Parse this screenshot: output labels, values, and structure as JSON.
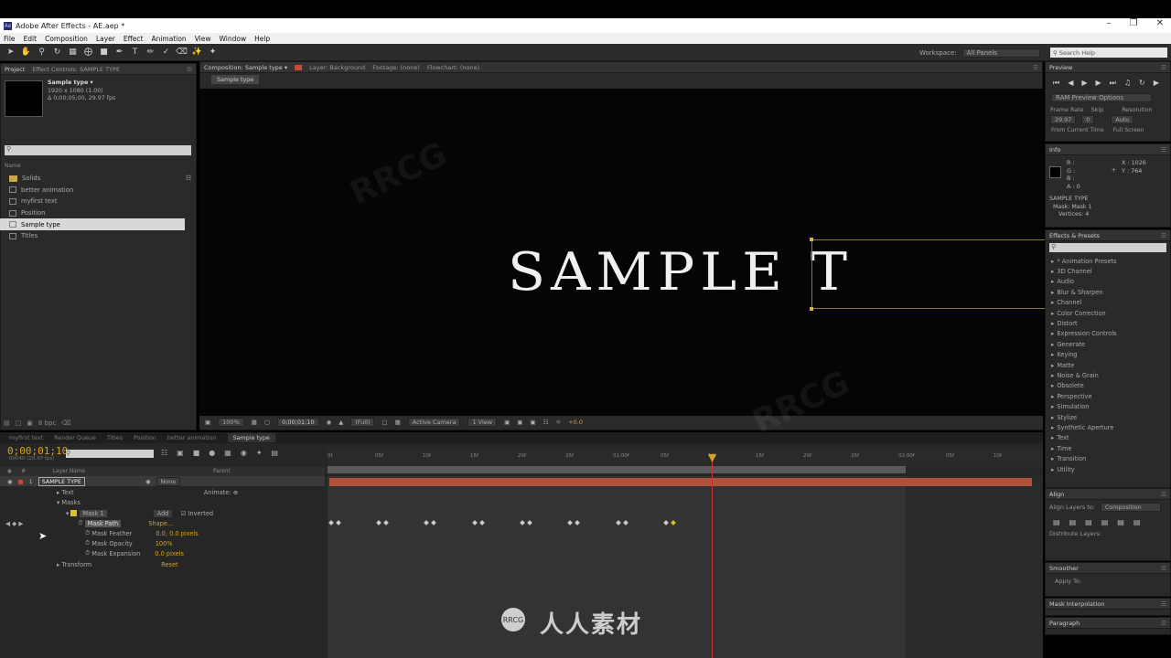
{
  "window": {
    "title": "Adobe After Effects - AE.aep *",
    "icon": "Ae"
  },
  "menu": [
    "File",
    "Edit",
    "Composition",
    "Layer",
    "Effect",
    "Animation",
    "View",
    "Window",
    "Help"
  ],
  "workspace": {
    "label": "Workspace:",
    "value": "All Panels"
  },
  "search_help": {
    "placeholder": "Search Help"
  },
  "project": {
    "tab": "Project",
    "tab2": "Effect Controls: SAMPLE TYPE",
    "selected_name": "Sample type ▾",
    "selected_dims": "1920 x 1080 (1.00)",
    "selected_dur": "Δ 0;00;05;00, 29.97 fps",
    "name_col": "Name",
    "items": [
      {
        "name": "Solids",
        "type": "folder"
      },
      {
        "name": "better animation",
        "type": "comp"
      },
      {
        "name": "myfirst text",
        "type": "comp"
      },
      {
        "name": "Position",
        "type": "comp"
      },
      {
        "name": "Sample type",
        "type": "comp",
        "selected": true
      },
      {
        "name": "Titles",
        "type": "comp"
      }
    ],
    "bpc": "8 bpc"
  },
  "composition": {
    "tab": "Composition: Sample type ▾",
    "layer_tab": "Layer: Background",
    "footage_tab": "Footage: (none)",
    "flowchart_tab": "Flowchart: (none)",
    "comp_name": "Sample type",
    "canvas_text": "SAMPLE T",
    "zoom": "100%",
    "time": "0;00;01;10",
    "resolution": "(Full)",
    "camera": "Active Camera",
    "views": "1 View",
    "exposure": "+0.0"
  },
  "preview": {
    "title": "Preview",
    "ram": "RAM Preview Options",
    "frame_rate_label": "Frame Rate",
    "skip_label": "Skip",
    "res_label": "Resolution",
    "frame_rate": "29.97",
    "skip": "0",
    "resolution": "Auto",
    "from_current": "From Current Time",
    "full_screen": "Full Screen"
  },
  "info": {
    "title": "Info",
    "r": "R :",
    "g": "G :",
    "b": "B :",
    "a": "A : 0",
    "x": "X : 1026",
    "y": "Y : 764",
    "layer": "SAMPLE TYPE",
    "mask": "Mask: Mask 1",
    "vertices": "Vertices: 4"
  },
  "effects": {
    "title": "Effects & Presets",
    "items": [
      "* Animation Presets",
      "3D Channel",
      "Audio",
      "Blur & Sharpen",
      "Channel",
      "Color Correction",
      "Distort",
      "Expression Controls",
      "Generate",
      "Keying",
      "Matte",
      "Noise & Grain",
      "Obsolete",
      "Perspective",
      "Simulation",
      "Stylize",
      "Synthetic Aperture",
      "Text",
      "Time",
      "Transition",
      "Utility"
    ]
  },
  "align": {
    "title": "Align",
    "layers_to_label": "Align Layers to:",
    "layers_to": "Composition",
    "distribute": "Distribute Layers:"
  },
  "smoother": {
    "title": "Smoother",
    "apply_to": "Apply To:"
  },
  "mask_interpolation": {
    "title": "Mask Interpolation"
  },
  "paragraph": {
    "title": "Paragraph"
  },
  "timeline": {
    "tabs": [
      "myfirst text",
      "Render Queue",
      "Titles",
      "Position",
      "better animation",
      "Sample type"
    ],
    "timecode": "0;00;01;10",
    "subtime": "00040 (29.97 fps)",
    "cols": {
      "num": "#",
      "layer_name": "Layer Name",
      "parent": "Parent"
    },
    "layer": {
      "num": "1",
      "name": "SAMPLE TYPE",
      "parent": "None"
    },
    "props": [
      {
        "label": "Text",
        "indent": 1,
        "value": "",
        "extra": "Animate:"
      },
      {
        "label": "Masks",
        "indent": 1
      },
      {
        "label": "Mask 1",
        "indent": 2,
        "value": "Add",
        "extra": "Inverted"
      },
      {
        "label": "Mask Path",
        "indent": 3,
        "value": "Shape..."
      },
      {
        "label": "Mask Feather",
        "indent": 3,
        "value": "0.0, 0.0 pixels"
      },
      {
        "label": "Mask Opacity",
        "indent": 3,
        "value": "100%"
      },
      {
        "label": "Mask Expansion",
        "indent": 3,
        "value": "0.0 pixels"
      },
      {
        "label": "Transform",
        "indent": 1,
        "value": "Reset"
      }
    ],
    "ruler": [
      "0f",
      "05f",
      "10f",
      "15f",
      "20f",
      "25f",
      "01:00f",
      "05f",
      "10f",
      "15f",
      "20f",
      "25f",
      "02:00f",
      "05f",
      "10f"
    ]
  },
  "watermark": {
    "text": "人人素材",
    "logo": "RRCG",
    "bg": "RRCG"
  }
}
